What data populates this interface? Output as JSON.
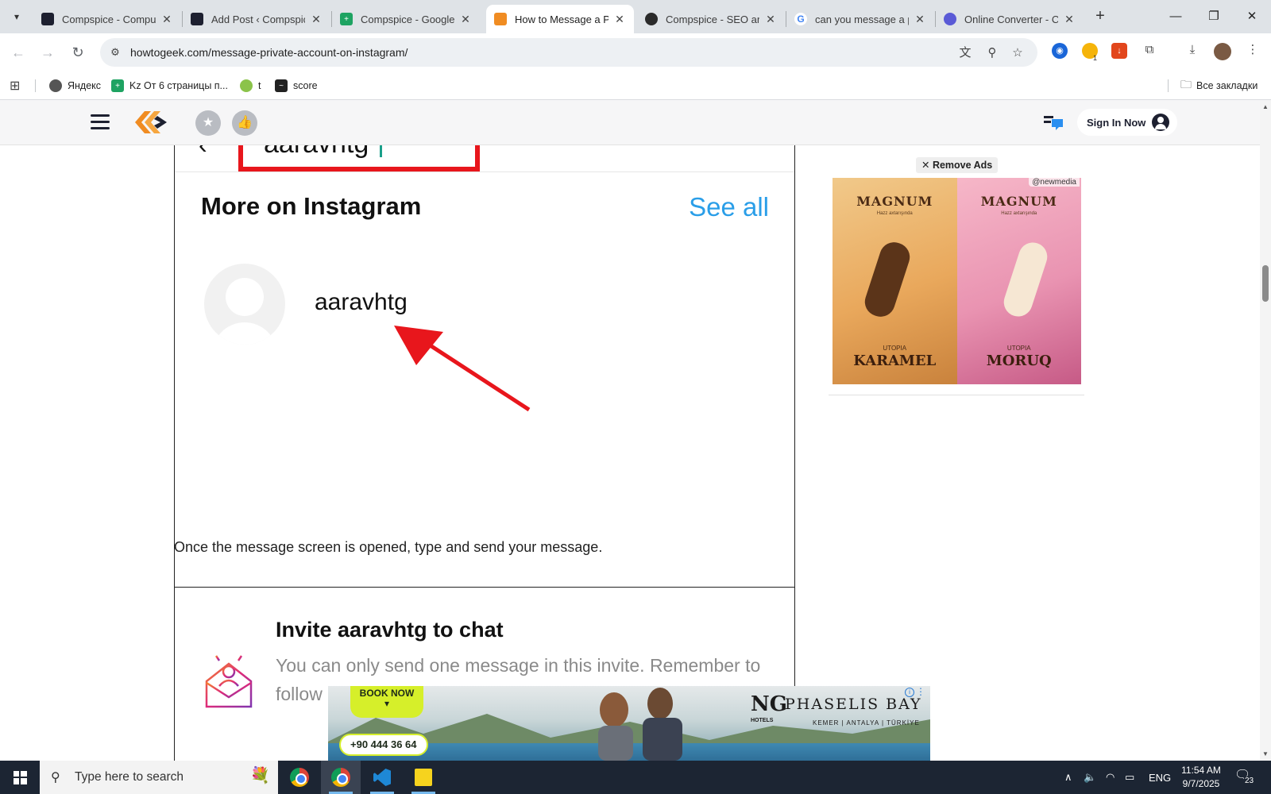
{
  "browser": {
    "tabs": [
      {
        "title": "Compspice - Computer",
        "favicon_color": "#1d2030",
        "active": false
      },
      {
        "title": "Add Post ‹ Compspice",
        "favicon_color": "#1d2030",
        "active": false
      },
      {
        "title": "Compspice - Google Sheets",
        "favicon_color": "#1ea362",
        "active": false
      },
      {
        "title": "How to Message a Private",
        "favicon_color": "#f08c22",
        "active": true
      },
      {
        "title": "Compspice - SEO article",
        "favicon_color": "#2a2a2a",
        "active": false
      },
      {
        "title": "can you message a private",
        "favicon_color": "#4285f4",
        "active": false
      },
      {
        "title": "Online Converter - Convert",
        "favicon_color": "#5a5ad6",
        "active": false
      }
    ],
    "url": "howtogeek.com/message-private-account-on-instagram/",
    "extension_badge": "1",
    "bookmarks": [
      {
        "label": "Яндекс",
        "color": "#555555"
      },
      {
        "label": "Kz От 6 страницы п...",
        "color": "#1ea362"
      },
      {
        "label": "t",
        "color": "#8bc34a"
      },
      {
        "label": "score",
        "color": "#222222"
      }
    ],
    "all_bookmarks": "Все закладки"
  },
  "site": {
    "sign_in": "Sign In Now",
    "accent": "#f08c22"
  },
  "article": {
    "shot1": {
      "search_text": "aaravhtg",
      "section_title": "More on Instagram",
      "see_all": "See all",
      "username": "aaravhtg"
    },
    "caption": "Once the message screen is opened, type and send your message.",
    "shot2": {
      "title": "Invite aaravhtg to chat",
      "body": "You can only send one message in this invite. Remember to follow Community Guidelines and be respectful when"
    }
  },
  "ads": {
    "remove_ads": "Remove Ads",
    "side": {
      "handle": "@newmedia",
      "brand": "MAGNUM",
      "brand_sub": "Hazz axtarışında",
      "left_sub": "UTOPIA",
      "left_flavor": "KARAMEL",
      "right_sub": "UTOPIA",
      "right_flavor": "MORUQ"
    },
    "bottom": {
      "book_now": "BOOK NOW",
      "phone": "+90 444 36 64",
      "mark": "NG",
      "mark_sub": "HOTELS",
      "hotel": "PHASELIS BAY",
      "location": "KEMER | ANTALYA | TÜRKİYE"
    }
  },
  "taskbar": {
    "search_placeholder": "Type here to search",
    "language": "ENG",
    "time": "11:54 AM",
    "date": "9/7/2025",
    "notifications": "23"
  }
}
